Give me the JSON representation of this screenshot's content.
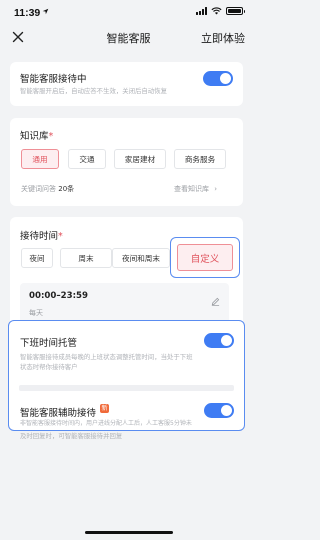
{
  "status_bar": {
    "time": "11:39"
  },
  "nav": {
    "title": "智能客服",
    "action": "立即体验"
  },
  "assistant": {
    "title": "智能客服接待中",
    "desc": "智能客服开启后，自动应答不生效，关闭后自动恢复",
    "enabled": true
  },
  "knowledge": {
    "title": "知识库",
    "required_mark": "*",
    "options": [
      "通用",
      "交通",
      "家居建材",
      "商务服务"
    ],
    "selected": "通用",
    "qa_label": "关键词问答",
    "qa_count": "20条",
    "view_link": "查看知识库"
  },
  "reception": {
    "title": "接待时间",
    "required_mark": "*",
    "options": [
      "夜间",
      "周末",
      "夜间和周末",
      "自定义"
    ],
    "selected": "自定义",
    "range": "00:00–23:59",
    "repeat": "每天"
  },
  "offwork": {
    "title": "下班时间托管",
    "desc_line1": "智能客服接待成员每晚的上班状态调整托管时间，当处于下班",
    "desc_line2": "状态时帮你接待客户",
    "enabled": true
  },
  "assist": {
    "title": "智能客服辅助接待",
    "badge": "新",
    "desc_line1": "非智能客服接待时间内，用户进线分配人工后，人工客服5分钟未",
    "desc_line2": "及时回复时，可智能客服接待并回复",
    "enabled": true
  },
  "colors": {
    "accent": "#3f7cf3",
    "selected_red": "#e0505a",
    "highlight_border": "#5a8cf0"
  }
}
